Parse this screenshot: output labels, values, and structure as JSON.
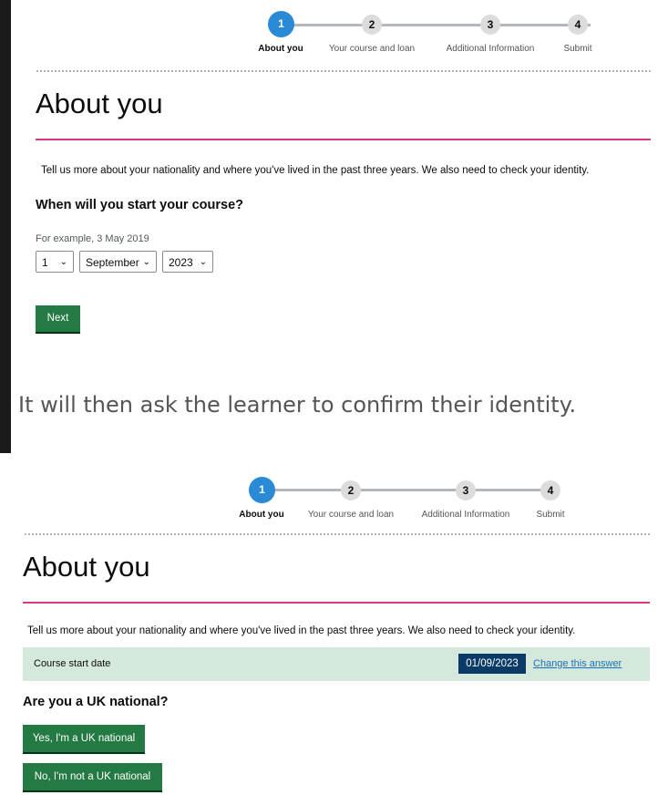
{
  "stepper": {
    "steps": [
      {
        "number": "1",
        "label": "About you"
      },
      {
        "number": "2",
        "label": "Your course and loan"
      },
      {
        "number": "3",
        "label": "Additional Information"
      },
      {
        "number": "4",
        "label": "Submit"
      }
    ],
    "active_step": 1
  },
  "screen1": {
    "title": "About you",
    "intro": "Tell us more about your nationality and where you've lived in the past three years. We also need to check your identity.",
    "question": "When will you start your course?",
    "hint": "For example, 3 May 2019",
    "date": {
      "day": "1",
      "month": "September",
      "year": "2023"
    },
    "next_label": "Next"
  },
  "caption": "It will then ask the learner to confirm their identity.",
  "screen2": {
    "title": "About you",
    "intro": "Tell us more about your nationality and where you've lived in the past three years. We also need to check your identity.",
    "summary": {
      "label": "Course start date",
      "value": "01/09/2023",
      "change_link": "Change this answer"
    },
    "question": "Are you a UK national?",
    "yes_label": "Yes, I'm a UK national",
    "no_label": "No, I'm not a UK national"
  },
  "colors": {
    "primary_button": "#237a42",
    "stepper_active": "#2b8ad6",
    "title_rule": "#d63a8f",
    "summary_bg": "#d4e8dc",
    "summary_value_bg": "#0a3b67",
    "link": "#1d70b8"
  }
}
